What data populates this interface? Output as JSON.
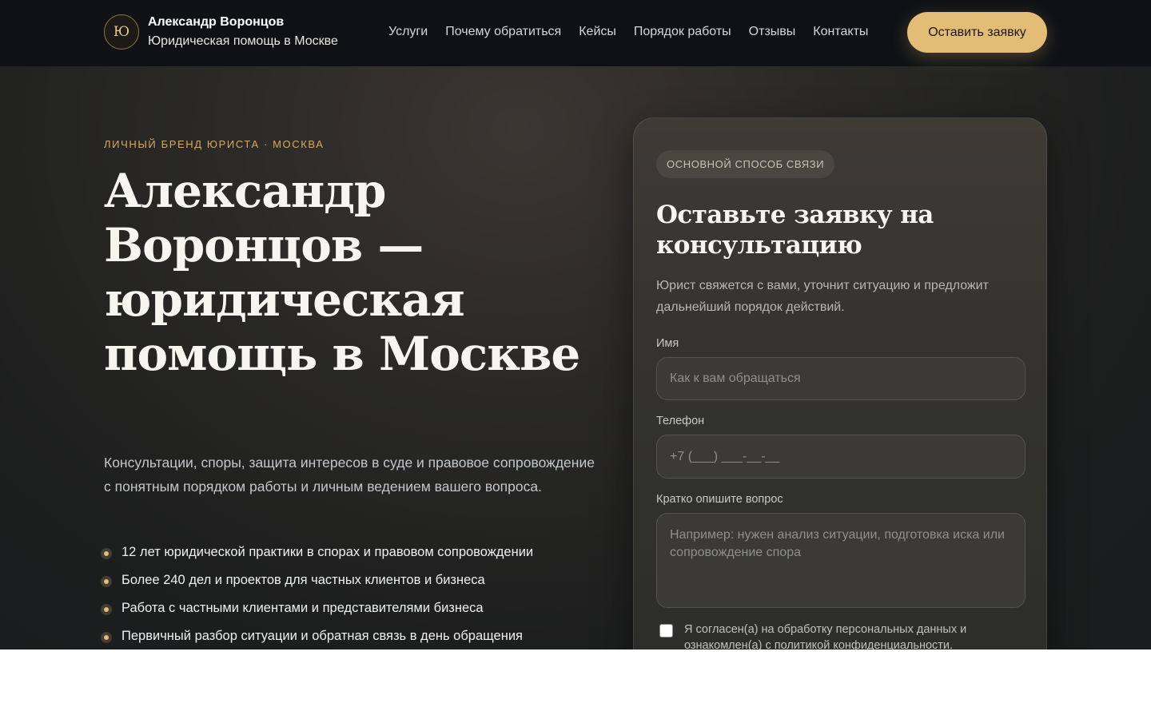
{
  "header": {
    "logo_mark": "Ю",
    "brand_name": "Александр Воронцов",
    "brand_subtitle": "Юридическая помощь в Москве",
    "nav": [
      "Услуги",
      "Почему обратиться",
      "Кейсы",
      "Порядок работы",
      "Отзывы",
      "Контакты"
    ],
    "cta_label": "Оставить заявку"
  },
  "hero": {
    "eyebrow": "ЛИЧНЫЙ БРЕНД ЮРИСТА · МОСКВА",
    "title": "Александр Воронцов — юридическая помощь в Москве",
    "lead": "Консультации, споры, защита интересов в суде и правовое сопровождение с понятным порядком работы и личным ведением вашего вопроса.",
    "bullets": [
      "12 лет юридической практики в спорах и правовом сопровождении",
      "Более 240 дел и проектов для частных клиентов и бизнеса",
      "Работа с частными клиентами и представителями бизнеса",
      "Первичный разбор ситуации и обратная связь в день обращения"
    ]
  },
  "form": {
    "badge": "ОСНОВНОЙ СПОСОБ СВЯЗИ",
    "title": "Оставьте заявку на консультацию",
    "description": "Юрист свяжется с вами, уточнит ситуацию и предложит дальнейший порядок действий.",
    "name_label": "Имя",
    "name_placeholder": "Как к вам обращаться",
    "phone_label": "Телефон",
    "phone_placeholder": "+7 (___) ___-__-__",
    "question_label": "Кратко опишите вопрос",
    "question_placeholder": "Например: нужен анализ ситуации, подготовка иска или сопровождение спора",
    "consent_text": "Я согласен(а) на обработку персональных данных и ознакомлен(а) с политикой конфиденциальности."
  },
  "colors": {
    "accent": "#e3bd76",
    "eyebrow": "#d6a95e",
    "header_bg": "#0f1115",
    "page_bg": "#1d1e1e",
    "card_bg": "#34332f"
  }
}
